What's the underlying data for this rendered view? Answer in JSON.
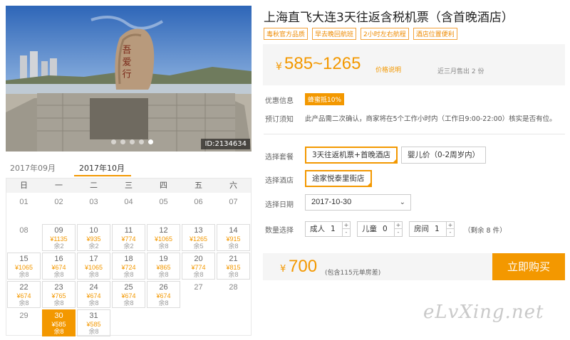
{
  "photo": {
    "image_id": "ID:2134634",
    "stone_text": "吾 爱 行",
    "slides": 5,
    "active_slide": 5
  },
  "calendar": {
    "tabs": [
      "2017年09月",
      "2017年10月"
    ],
    "active_tab": 1,
    "weekdays": [
      "日",
      "一",
      "二",
      "三",
      "四",
      "五",
      "六"
    ],
    "days": [
      {
        "d": "01"
      },
      {
        "d": "02"
      },
      {
        "d": "03"
      },
      {
        "d": "04"
      },
      {
        "d": "05"
      },
      {
        "d": "06"
      },
      {
        "d": "07"
      },
      {
        "d": "08"
      },
      {
        "d": "09",
        "p": "¥1135",
        "r": "余2"
      },
      {
        "d": "10",
        "p": "¥935",
        "r": "余2"
      },
      {
        "d": "11",
        "p": "¥774",
        "r": "余2"
      },
      {
        "d": "12",
        "p": "¥1065",
        "r": "余8"
      },
      {
        "d": "13",
        "p": "¥1265",
        "r": "余5"
      },
      {
        "d": "14",
        "p": "¥915",
        "r": "余8"
      },
      {
        "d": "15",
        "p": "¥1065",
        "r": "余8"
      },
      {
        "d": "16",
        "p": "¥674",
        "r": "余8"
      },
      {
        "d": "17",
        "p": "¥1065",
        "r": "余8"
      },
      {
        "d": "18",
        "p": "¥724",
        "r": "余8"
      },
      {
        "d": "19",
        "p": "¥865",
        "r": "余8"
      },
      {
        "d": "20",
        "p": "¥774",
        "r": "余8"
      },
      {
        "d": "21",
        "p": "¥815",
        "r": "余8"
      },
      {
        "d": "22",
        "p": "¥674",
        "r": "余8"
      },
      {
        "d": "23",
        "p": "¥765",
        "r": "余8"
      },
      {
        "d": "24",
        "p": "¥674",
        "r": "余8"
      },
      {
        "d": "25",
        "p": "¥674",
        "r": "余8"
      },
      {
        "d": "26",
        "p": "¥674",
        "r": "余8"
      },
      {
        "d": "27"
      },
      {
        "d": "28"
      },
      {
        "d": "29"
      },
      {
        "d": "30",
        "p": "¥585",
        "r": "余8",
        "selected": true
      },
      {
        "d": "31",
        "p": "¥585",
        "r": "余8"
      }
    ]
  },
  "product": {
    "title": "上海直飞大连3天往返含税机票（含首晚酒店）",
    "tags": [
      "毒秋官方品质",
      "早去晚回航班",
      "2小时左右航程",
      "酒店位置便利"
    ],
    "price_yen": "¥",
    "price_range": "585~1265",
    "price_note": "价格说明",
    "sold": "近三月售出 2 份"
  },
  "info": {
    "promo_label": "优惠信息",
    "promo_badge": "蜂蜜抵10%",
    "notice_label": "预订须知",
    "notice_text": "此产品需二次确认，商家将在5个工作小时内（工作日9:00-22:00）核实是否有位。"
  },
  "options": {
    "package_label": "选择套餐",
    "packages": [
      "3天往返机票+首晚酒店",
      "婴儿价（0-2周岁内）"
    ],
    "hotel_label": "选择酒店",
    "hotel": "途家悦泰里街店",
    "date_label": "选择日期",
    "date_value": "2017-10-30",
    "qty_label": "数量选择",
    "adult_label": "成人",
    "adult_value": "1",
    "child_label": "儿童",
    "child_value": "0",
    "room_label": "房间",
    "room_value": "1",
    "remain": "（剩余 8 件）",
    "plus": "+",
    "minus": "-"
  },
  "purchase": {
    "yen": "¥",
    "total": "700",
    "note": "(包含115元单房差)",
    "buy_label": "立即购买"
  },
  "watermark": "eLvXing.net",
  "colors": {
    "accent": "#f39800"
  }
}
